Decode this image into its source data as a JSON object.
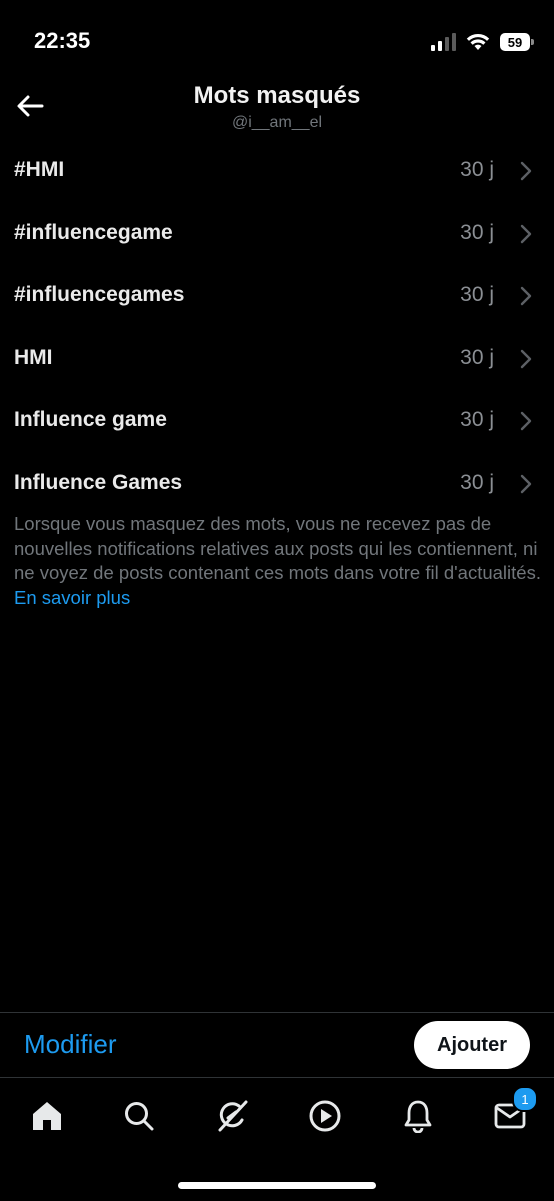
{
  "status_bar": {
    "time": "22:35",
    "battery": "59"
  },
  "header": {
    "title": "Mots masqués",
    "subtitle": "@i__am__el"
  },
  "muted_words": [
    {
      "word": "#HMI",
      "duration": "30 j"
    },
    {
      "word": "#influencegame",
      "duration": "30 j"
    },
    {
      "word": "#influencegames",
      "duration": "30 j"
    },
    {
      "word": "HMI",
      "duration": "30 j"
    },
    {
      "word": "Influence game",
      "duration": "30 j"
    },
    {
      "word": "Influence Games",
      "duration": "30 j"
    }
  ],
  "note": {
    "text": "Lorsque vous masquez des mots, vous ne recevez pas de nouvelles notifications relatives aux posts qui les contiennent, ni ne voyez de posts contenant ces mots dans votre fil d'actualités.",
    "link": "En savoir plus"
  },
  "actions": {
    "edit": "Modifier",
    "add": "Ajouter"
  },
  "tabbar": {
    "icons": [
      "home-icon",
      "search-icon",
      "grok-icon",
      "video-icon",
      "notifications-icon",
      "messages-icon"
    ],
    "messages_badge": "1"
  },
  "colors": {
    "accent": "#1d9bf0",
    "background": "#000000",
    "muted_text": "#71767b"
  }
}
